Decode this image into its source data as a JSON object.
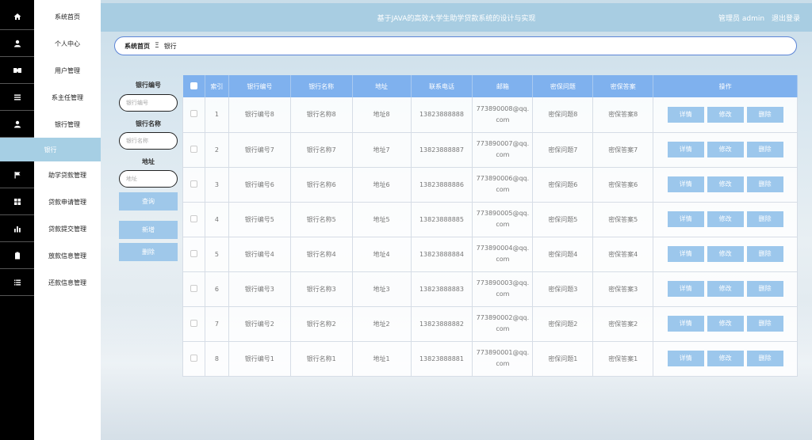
{
  "app": {
    "title": "基于JAVA的高效大学生助学贷款系统的设计与实现",
    "user": "管理员 admin",
    "logout": "退出登录"
  },
  "breadcrumb": {
    "home": "系统首页",
    "sep": "Ξ",
    "current": "银行"
  },
  "sidebar": {
    "items": [
      {
        "label": "系统首页",
        "icon": "home-icon"
      },
      {
        "label": "个人中心",
        "icon": "user-icon"
      },
      {
        "label": "用户管理",
        "icon": "users-icon"
      },
      {
        "label": "系主任管理",
        "icon": "list-icon"
      },
      {
        "label": "银行管理",
        "icon": "user-icon"
      },
      {
        "label": "助学贷款管理",
        "icon": "flag-icon"
      },
      {
        "label": "贷款申请管理",
        "icon": "grid-icon"
      },
      {
        "label": "贷款提交管理",
        "icon": "bar-chart-icon"
      },
      {
        "label": "放款信息管理",
        "icon": "clipboard-icon"
      },
      {
        "label": "还款信息管理",
        "icon": "list-icon"
      }
    ],
    "sub_item": "银行"
  },
  "search": {
    "code_label": "银行编号",
    "code_placeholder": "银行编号",
    "name_label": "银行名称",
    "name_placeholder": "银行名称",
    "addr_label": "地址",
    "addr_placeholder": "地址",
    "query_btn": "查询",
    "add_btn": "新增",
    "delete_btn": "删除"
  },
  "table": {
    "headers": [
      "索引",
      "银行编号",
      "银行名称",
      "地址",
      "联系电话",
      "邮箱",
      "密保问题",
      "密保答案",
      "操作"
    ],
    "actions": {
      "detail": "详情",
      "edit": "修改",
      "delete": "删除"
    },
    "rows": [
      {
        "idx": "1",
        "code": "银行编号8",
        "name": "银行名称8",
        "addr": "地址8",
        "phone": "13823888888",
        "email1": "773890008@qq.",
        "email2": "com",
        "q": "密保问题8",
        "a": "密保答案8"
      },
      {
        "idx": "2",
        "code": "银行编号7",
        "name": "银行名称7",
        "addr": "地址7",
        "phone": "13823888887",
        "email1": "773890007@qq.",
        "email2": "com",
        "q": "密保问题7",
        "a": "密保答案7"
      },
      {
        "idx": "3",
        "code": "银行编号6",
        "name": "银行名称6",
        "addr": "地址6",
        "phone": "13823888886",
        "email1": "773890006@qq.",
        "email2": "com",
        "q": "密保问题6",
        "a": "密保答案6"
      },
      {
        "idx": "4",
        "code": "银行编号5",
        "name": "银行名称5",
        "addr": "地址5",
        "phone": "13823888885",
        "email1": "773890005@qq.",
        "email2": "com",
        "q": "密保问题5",
        "a": "密保答案5"
      },
      {
        "idx": "5",
        "code": "银行编号4",
        "name": "银行名称4",
        "addr": "地址4",
        "phone": "13823888884",
        "email1": "773890004@qq.",
        "email2": "com",
        "q": "密保问题4",
        "a": "密保答案4"
      },
      {
        "idx": "6",
        "code": "银行编号3",
        "name": "银行名称3",
        "addr": "地址3",
        "phone": "13823888883",
        "email1": "773890003@qq.",
        "email2": "com",
        "q": "密保问题3",
        "a": "密保答案3"
      },
      {
        "idx": "7",
        "code": "银行编号2",
        "name": "银行名称2",
        "addr": "地址2",
        "phone": "13823888882",
        "email1": "773890002@qq.",
        "email2": "com",
        "q": "密保问题2",
        "a": "密保答案2"
      },
      {
        "idx": "8",
        "code": "银行编号1",
        "name": "银行名称1",
        "addr": "地址1",
        "phone": "13823888881",
        "email1": "773890001@qq.",
        "email2": "com",
        "q": "密保问题1",
        "a": "密保答案1"
      }
    ]
  }
}
